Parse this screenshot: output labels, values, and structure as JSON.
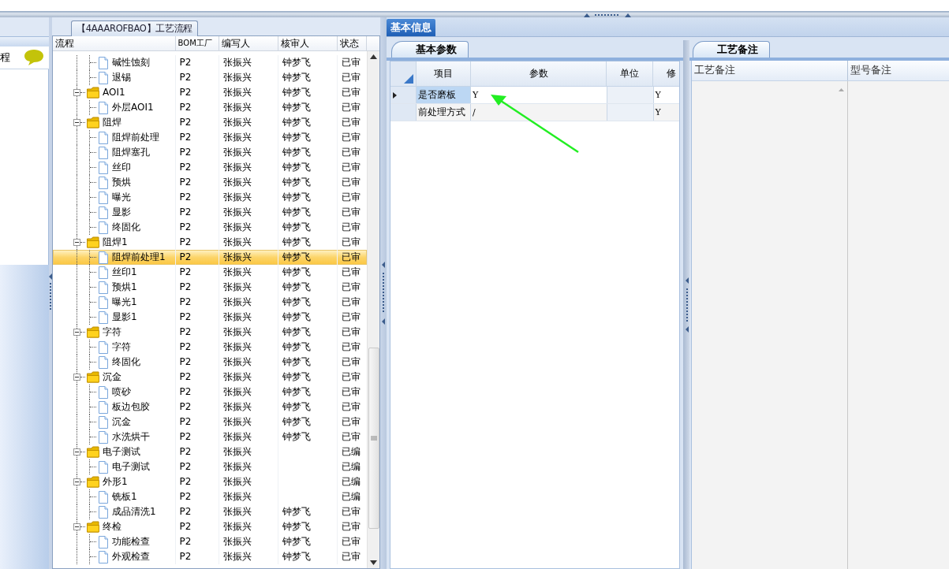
{
  "sidebar": {
    "label": "程"
  },
  "flow_panel": {
    "title": "【4AAAROFBAO】工艺流程",
    "columns": [
      "流程",
      "BOM工厂",
      "编写人",
      "核审人",
      "状态"
    ],
    "nodes": [
      {
        "kind": "file",
        "name": "碱性蚀刻",
        "bom": "P2",
        "writer": "张振兴",
        "reviewer": "钟梦飞",
        "status": "已审",
        "selected": false
      },
      {
        "kind": "file",
        "name": "退锡",
        "bom": "P2",
        "writer": "张振兴",
        "reviewer": "钟梦飞",
        "status": "已审",
        "selected": false
      },
      {
        "kind": "folder",
        "name": "AOI1",
        "bom": "P2",
        "writer": "张振兴",
        "reviewer": "钟梦飞",
        "status": "已审",
        "selected": false,
        "expanded": true,
        "children": [
          {
            "kind": "file",
            "name": "外层AOI1",
            "bom": "P2",
            "writer": "张振兴",
            "reviewer": "钟梦飞",
            "status": "已审",
            "selected": false
          }
        ]
      },
      {
        "kind": "folder",
        "name": "阻焊",
        "bom": "P2",
        "writer": "张振兴",
        "reviewer": "钟梦飞",
        "status": "已审",
        "selected": false,
        "expanded": true,
        "children": [
          {
            "kind": "file",
            "name": "阻焊前处理",
            "bom": "P2",
            "writer": "张振兴",
            "reviewer": "钟梦飞",
            "status": "已审",
            "selected": false
          },
          {
            "kind": "file",
            "name": "阻焊塞孔",
            "bom": "P2",
            "writer": "张振兴",
            "reviewer": "钟梦飞",
            "status": "已审",
            "selected": false
          },
          {
            "kind": "file",
            "name": "丝印",
            "bom": "P2",
            "writer": "张振兴",
            "reviewer": "钟梦飞",
            "status": "已审",
            "selected": false
          },
          {
            "kind": "file",
            "name": "预烘",
            "bom": "P2",
            "writer": "张振兴",
            "reviewer": "钟梦飞",
            "status": "已审",
            "selected": false
          },
          {
            "kind": "file",
            "name": "曝光",
            "bom": "P2",
            "writer": "张振兴",
            "reviewer": "钟梦飞",
            "status": "已审",
            "selected": false
          },
          {
            "kind": "file",
            "name": "显影",
            "bom": "P2",
            "writer": "张振兴",
            "reviewer": "钟梦飞",
            "status": "已审",
            "selected": false
          },
          {
            "kind": "file",
            "name": "终固化",
            "bom": "P2",
            "writer": "张振兴",
            "reviewer": "钟梦飞",
            "status": "已审",
            "selected": false
          }
        ]
      },
      {
        "kind": "folder",
        "name": "阻焊1",
        "bom": "P2",
        "writer": "张振兴",
        "reviewer": "钟梦飞",
        "status": "已审",
        "selected": false,
        "expanded": true,
        "children": [
          {
            "kind": "file",
            "name": "阻焊前处理1",
            "bom": "P2",
            "writer": "张振兴",
            "reviewer": "钟梦飞",
            "status": "已审",
            "selected": true
          },
          {
            "kind": "file",
            "name": "丝印1",
            "bom": "P2",
            "writer": "张振兴",
            "reviewer": "钟梦飞",
            "status": "已审",
            "selected": false
          },
          {
            "kind": "file",
            "name": "预烘1",
            "bom": "P2",
            "writer": "张振兴",
            "reviewer": "钟梦飞",
            "status": "已审",
            "selected": false
          },
          {
            "kind": "file",
            "name": "曝光1",
            "bom": "P2",
            "writer": "张振兴",
            "reviewer": "钟梦飞",
            "status": "已审",
            "selected": false
          },
          {
            "kind": "file",
            "name": "显影1",
            "bom": "P2",
            "writer": "张振兴",
            "reviewer": "钟梦飞",
            "status": "已审",
            "selected": false
          }
        ]
      },
      {
        "kind": "folder",
        "name": "字符",
        "bom": "P2",
        "writer": "张振兴",
        "reviewer": "钟梦飞",
        "status": "已审",
        "selected": false,
        "expanded": true,
        "children": [
          {
            "kind": "file",
            "name": "字符",
            "bom": "P2",
            "writer": "张振兴",
            "reviewer": "钟梦飞",
            "status": "已审",
            "selected": false
          },
          {
            "kind": "file",
            "name": "终固化",
            "bom": "P2",
            "writer": "张振兴",
            "reviewer": "钟梦飞",
            "status": "已审",
            "selected": false
          }
        ]
      },
      {
        "kind": "folder",
        "name": "沉金",
        "bom": "P2",
        "writer": "张振兴",
        "reviewer": "钟梦飞",
        "status": "已审",
        "selected": false,
        "expanded": true,
        "children": [
          {
            "kind": "file",
            "name": "喷砂",
            "bom": "P2",
            "writer": "张振兴",
            "reviewer": "钟梦飞",
            "status": "已审",
            "selected": false
          },
          {
            "kind": "file",
            "name": "板边包胶",
            "bom": "P2",
            "writer": "张振兴",
            "reviewer": "钟梦飞",
            "status": "已审",
            "selected": false
          },
          {
            "kind": "file",
            "name": "沉金",
            "bom": "P2",
            "writer": "张振兴",
            "reviewer": "钟梦飞",
            "status": "已审",
            "selected": false
          },
          {
            "kind": "file",
            "name": "水洗烘干",
            "bom": "P2",
            "writer": "张振兴",
            "reviewer": "钟梦飞",
            "status": "已审",
            "selected": false
          }
        ]
      },
      {
        "kind": "folder",
        "name": "电子测试",
        "bom": "P2",
        "writer": "张振兴",
        "status": "已编",
        "selected": false,
        "expanded": true,
        "children": [
          {
            "kind": "file",
            "name": "电子测试",
            "bom": "P2",
            "writer": "张振兴",
            "status": "已编",
            "selected": false
          }
        ]
      },
      {
        "kind": "folder",
        "name": "外形1",
        "bom": "P2",
        "writer": "张振兴",
        "status": "已编",
        "selected": false,
        "expanded": true,
        "children": [
          {
            "kind": "file",
            "name": "铣板1",
            "bom": "P2",
            "writer": "张振兴",
            "status": "已编",
            "selected": false
          },
          {
            "kind": "file",
            "name": "成品清洗1",
            "bom": "P2",
            "writer": "张振兴",
            "reviewer": "钟梦飞",
            "status": "已审",
            "selected": false
          }
        ]
      },
      {
        "kind": "folder",
        "name": "终检",
        "bom": "P2",
        "writer": "张振兴",
        "reviewer": "钟梦飞",
        "status": "已审",
        "selected": false,
        "expanded": true,
        "children": [
          {
            "kind": "file",
            "name": "功能检查",
            "bom": "P2",
            "writer": "张振兴",
            "reviewer": "钟梦飞",
            "status": "已审",
            "selected": false
          },
          {
            "kind": "file",
            "name": "外观检查",
            "bom": "P2",
            "writer": "张振兴",
            "reviewer": "钟梦飞",
            "status": "已审",
            "selected": false
          }
        ]
      }
    ]
  },
  "info_tabs": [
    {
      "label": "基本信息",
      "selected": true
    }
  ],
  "params_panel": {
    "tab": "基本参数",
    "columns": [
      "项目",
      "参数",
      "单位",
      "修"
    ],
    "rows": [
      {
        "item": "是否磨板",
        "value": "Y",
        "column_4": "Y",
        "selected": true
      },
      {
        "item": "前处理方式",
        "value": "/",
        "column_4": "Y",
        "selected": false
      }
    ]
  },
  "notes_panel": {
    "tab": "工艺备注",
    "columns": [
      "工艺备注",
      "型号备注"
    ]
  }
}
